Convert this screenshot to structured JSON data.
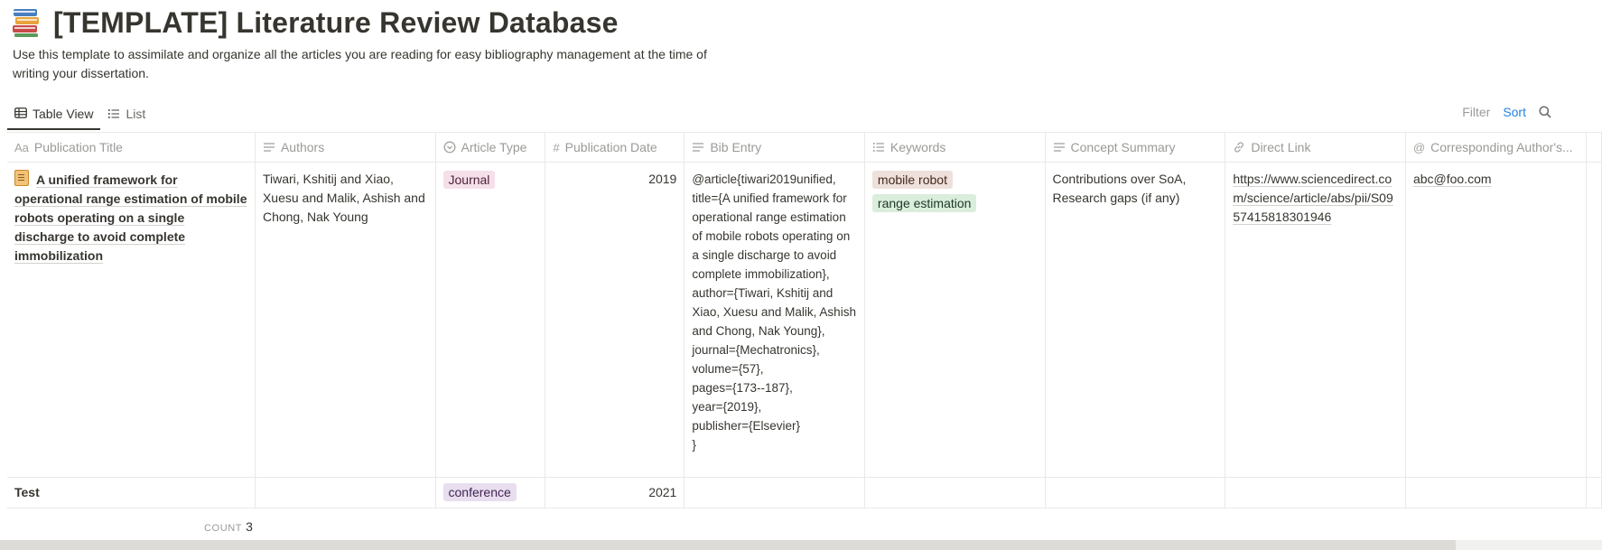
{
  "page": {
    "icon": "books-icon",
    "title": "[TEMPLATE] Literature Review Database",
    "description": "Use this template to assimilate and organize all the articles you are reading for easy bibliography management at the time of writing your dissertation."
  },
  "views": {
    "table_view": "Table View",
    "list": "List"
  },
  "actions": {
    "filter": "Filter",
    "sort": "Sort"
  },
  "columns": [
    {
      "label": "Publication Title",
      "icon": "Aa"
    },
    {
      "label": "Authors",
      "icon": "text-icon"
    },
    {
      "label": "Article Type",
      "icon": "select-icon"
    },
    {
      "label": "Publication Date",
      "icon": "#"
    },
    {
      "label": "Bib Entry",
      "icon": "text-icon"
    },
    {
      "label": "Keywords",
      "icon": "multiselect-icon"
    },
    {
      "label": "Concept Summary",
      "icon": "text-icon"
    },
    {
      "label": "Direct Link",
      "icon": "link-icon"
    },
    {
      "label": "Corresponding Author's...",
      "icon": "@"
    }
  ],
  "rows": [
    {
      "title": "A unified framework for operational range estimation of mobile robots operating on a single discharge to avoid complete immobilization",
      "authors": "Tiwari, Kshitij and Xiao, Xuesu and Malik, Ashish and Chong, Nak Young",
      "article_type": "Journal",
      "publication_date": "2019",
      "bib_entry": "@article{tiwari2019unified,\ntitle={A unified framework for operational range estimation of mobile robots operating on a single discharge to avoid complete immobilization},\nauthor={Tiwari, Kshitij and Xiao, Xuesu and Malik, Ashish and Chong, Nak Young},\njournal={Mechatronics},\nvolume={57},\npages={173--187},\nyear={2019},\npublisher={Elsevier}\n}",
      "keywords": [
        "mobile robot",
        "range estimation"
      ],
      "concept_summary": "Contributions over SoA, Research gaps (if any)",
      "direct_link": "https://www.sciencedirect.com/science/article/abs/pii/S0957415818301946",
      "corresponding_author": "abc@foo.com"
    },
    {
      "title": "Test",
      "article_type": "conference",
      "publication_date": "2021"
    }
  ],
  "footer": {
    "count_label": "COUNT",
    "count_value": "3"
  },
  "colors": {
    "accent": "#2383e2",
    "text": "#37352f",
    "muted": "#9b9a97",
    "tag_journal": "#f5e0e9",
    "tag_conference": "#e8deee",
    "tag_mobile_robot": "#eee0da",
    "tag_range_estimation": "#dbeddb"
  }
}
